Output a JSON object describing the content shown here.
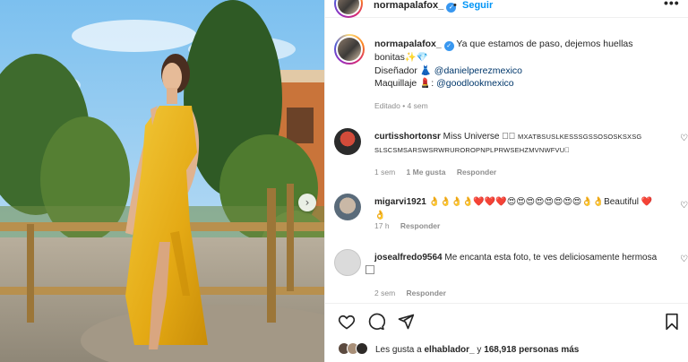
{
  "post": {
    "username": "normapalafox_",
    "verified_mark": "✓",
    "dot": "•",
    "follow_label": "Seguir",
    "more_label": "•••",
    "next_label": "›"
  },
  "caption": {
    "username": "normapalafox_",
    "line1": " Ya que estamos de paso, dejemos huellas",
    "line2": "bonitas✨💎",
    "designer_label": "Diseñador 👗 ",
    "designer_handle": "@danielperezmexico",
    "makeup_label": "Maquillaje 💄: ",
    "makeup_handle": "@goodlookmexico",
    "meta": "Editado • 4 sem"
  },
  "comments": [
    {
      "username": "curtisshortonsr",
      "text": " Miss Universe ⃞⃞ ",
      "text_small": "MXATBSUSLKESSSGSSOSOSKSXSG SLSCSMSARSWSRWRUROROPNPLPRWSEHZMVNWFVU⃞",
      "time": "1 sem",
      "likes": "1 Me gusta",
      "reply": "Responder"
    },
    {
      "username": "migarvi1921",
      "text": " 👌👌👌👌❤️❤️❤️😍😍😍😍😍😍😍😍👌👌Beautiful ❤️👌",
      "time": "17 h",
      "reply": "Responder"
    },
    {
      "username": "josealfredo9564",
      "text": " Me encanta esta foto, te ves deliciosamente hermosa ⃞⃞⃞⃞⃞⃞",
      "time": "2 sem",
      "reply": "Responder"
    }
  ],
  "likes": {
    "prefix": "Les gusta a ",
    "user": "elhablador_",
    "middle": " y ",
    "count": "168,918 personas más"
  },
  "icons": [
    "heart-icon",
    "comment-icon",
    "share-icon",
    "bookmark-icon",
    "more-icon",
    "chevron-right-icon"
  ],
  "colors": {
    "accent": "#0095f6",
    "verified": "#3897f0",
    "link": "#00376b",
    "muted": "#8e8e8e",
    "dress": "#e8b21d"
  }
}
